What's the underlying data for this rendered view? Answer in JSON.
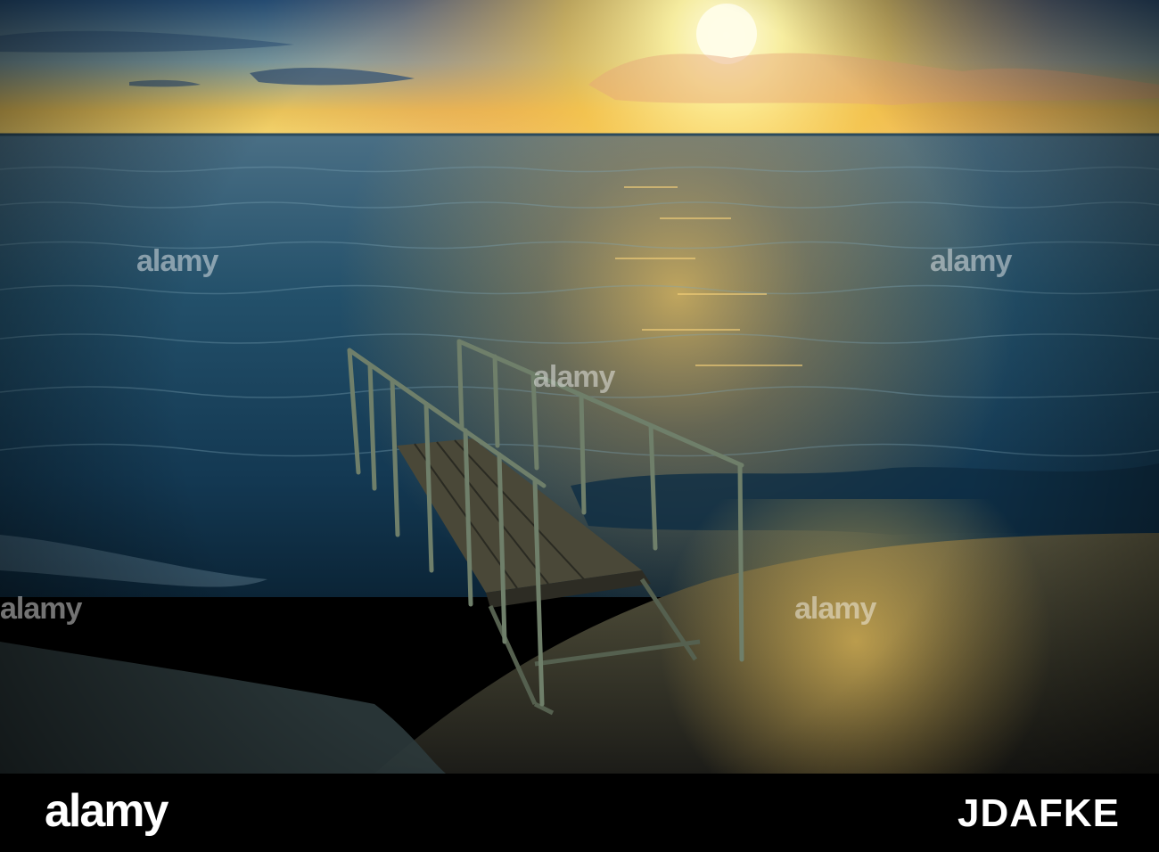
{
  "photo": {
    "subject": "sunset-over-sea-with-wooden-pier-and-railing",
    "colors": {
      "sky_top": "#2f5f8f",
      "sky_sun": "#fff6b0",
      "sky_orange": "#f7c24a",
      "sea_dark": "#0d2a40",
      "sea_mid": "#24566f",
      "sunpath": "#f0b94a",
      "shore": "#3d3a2c",
      "railing": "#6f7f6a",
      "deck": "#4a4838"
    }
  },
  "watermark": {
    "text": "alamy"
  },
  "footer": {
    "brand": "alamy",
    "image_id": "JDAFKE"
  }
}
